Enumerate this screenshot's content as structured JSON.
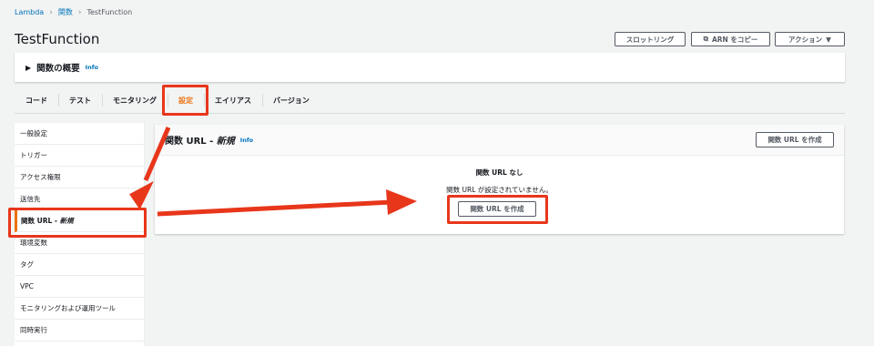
{
  "breadcrumb": {
    "root": "Lambda",
    "functions": "関数",
    "current": "TestFunction"
  },
  "page_title": "TestFunction",
  "header_buttons": {
    "throttle": "スロットリング",
    "copy_arn": "ARN をコピー",
    "actions": "アクション"
  },
  "overview": {
    "label": "関数の概要",
    "info": "Info"
  },
  "tabs": [
    "コード",
    "テスト",
    "モニタリング",
    "設定",
    "エイリアス",
    "バージョン"
  ],
  "active_tab": "設定",
  "sidebar": {
    "items": [
      "一般設定",
      "トリガー",
      "アクセス権限",
      "送信先"
    ],
    "active_prefix": "関数 URL - ",
    "active_suffix": "新規",
    "items_after": [
      "環境変数",
      "タグ",
      "VPC",
      "モニタリングおよび運用ツール",
      "同時実行"
    ]
  },
  "main": {
    "title_prefix": "関数 URL - ",
    "title_suffix": "新規",
    "info": "Info",
    "create_button": "関数 URL を作成",
    "empty_title": "関数 URL なし",
    "empty_desc": "関数 URL が設定されていません。",
    "empty_button": "関数 URL を作成"
  },
  "colors": {
    "accent": "#ec7211",
    "link": "#0073bb",
    "highlight": "#e8361b"
  }
}
